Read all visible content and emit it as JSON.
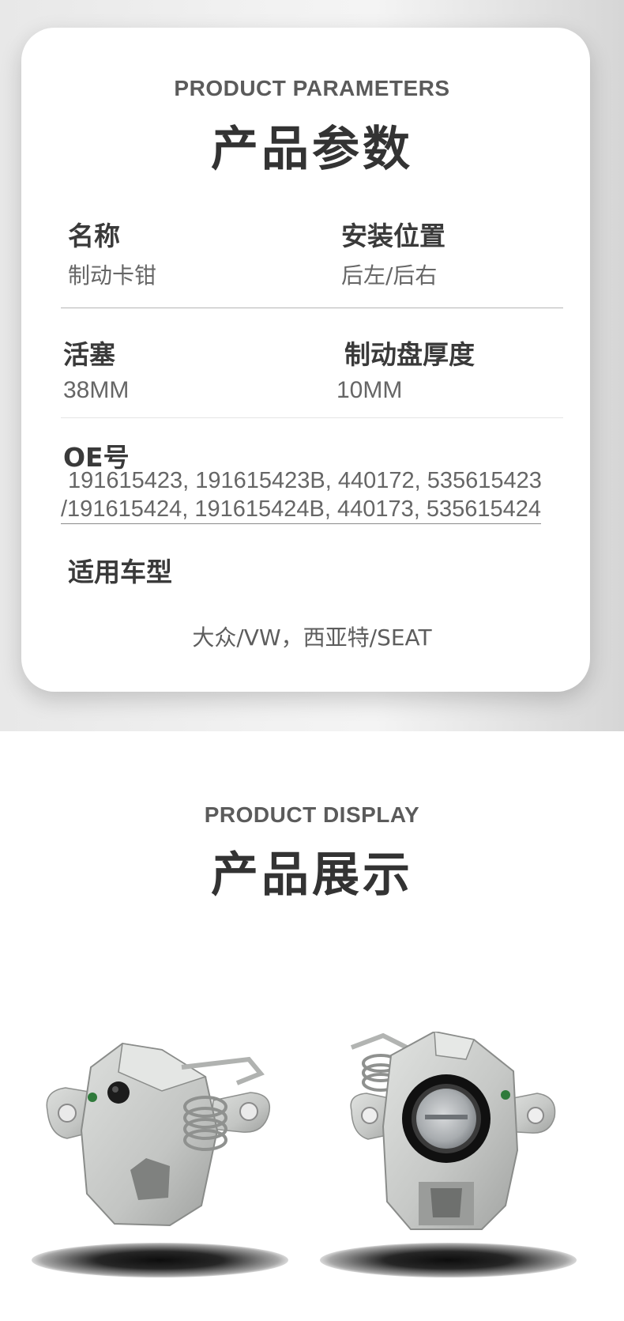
{
  "parameters": {
    "eyebrow": "PRODUCT PARAMETERS",
    "title": "产品参数",
    "name_label": "名称",
    "name_value": "制动卡钳",
    "position_label": "安装位置",
    "position_value": "后左/后右",
    "piston_label": "活塞",
    "piston_value": "38MM",
    "disc_label": "制动盘厚度",
    "disc_value": "10MM",
    "oe_label": "OE号",
    "oe_line1": "191615423, 191615423B, 440172, 535615423",
    "oe_line2": "/191615424, 191615424B, 440173, 535615424",
    "vehicle_label": "适用车型",
    "vehicle_value": "大众/VW，西亚特/SEAT"
  },
  "display": {
    "eyebrow": "PRODUCT DISPLAY",
    "title": "产品展示"
  },
  "colors": {
    "caliper_body": "#c8cac8",
    "caliper_shade": "#9a9c9a",
    "seal_black": "#151515",
    "piston_metal": "#a9adb0"
  }
}
